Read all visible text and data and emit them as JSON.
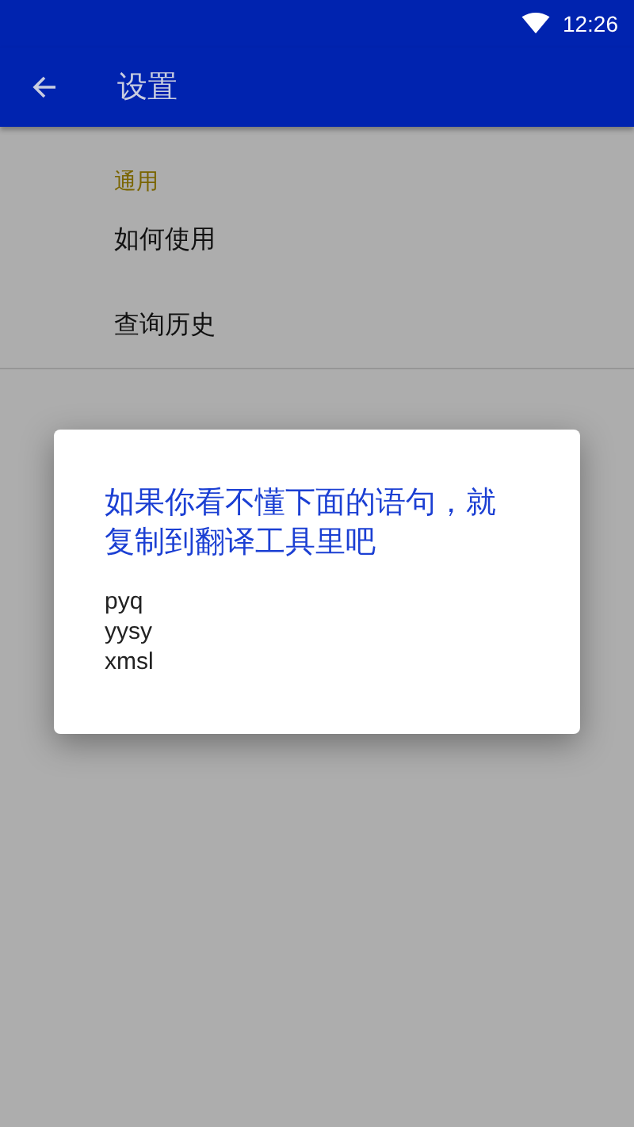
{
  "status_bar": {
    "time": "12:26"
  },
  "app_bar": {
    "title": "设置"
  },
  "sections": [
    {
      "header": "通用",
      "items": [
        "如何使用",
        "查询历史"
      ]
    }
  ],
  "dialog": {
    "title": "如果你看不懂下面的语句，就复制到翻译工具里吧",
    "lines": [
      "pyq",
      "yysy",
      "xmsl"
    ]
  }
}
